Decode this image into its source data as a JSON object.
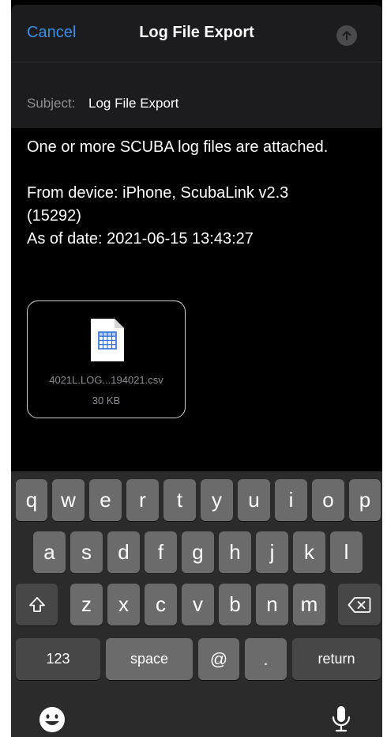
{
  "header": {
    "cancel_label": "Cancel",
    "title": "Log File Export",
    "send_icon": "arrow-up-icon"
  },
  "subject": {
    "label": "Subject:",
    "value": "Log File Export"
  },
  "body": {
    "line1": "One or more SCUBA log files are attached.",
    "line2": "From device: iPhone,  ScubaLink v2.3",
    "line3": "(15292)",
    "line4": "As of date: 2021-06-15 13:43:27"
  },
  "attachment": {
    "filename": "4021L.LOG...194021.csv",
    "size": "30 KB",
    "icon": "spreadsheet-file-icon"
  },
  "keyboard": {
    "row1": [
      "q",
      "w",
      "e",
      "r",
      "t",
      "y",
      "u",
      "i",
      "o",
      "p"
    ],
    "row2": [
      "a",
      "s",
      "d",
      "f",
      "g",
      "h",
      "j",
      "k",
      "l"
    ],
    "row3": [
      "z",
      "x",
      "c",
      "v",
      "b",
      "n",
      "m"
    ],
    "numbers_label": "123",
    "space_label": "space",
    "at_label": "@",
    "period_label": ".",
    "return_label": "return",
    "shift_icon": "shift-icon",
    "delete_icon": "delete-icon",
    "emoji_icon": "emoji-icon",
    "mic_icon": "microphone-icon"
  },
  "colors": {
    "accent": "#3a8ee6",
    "background": "#000000",
    "bar": "#1c1c1e",
    "key": "#6b6b6b",
    "key_dark": "#474747"
  }
}
